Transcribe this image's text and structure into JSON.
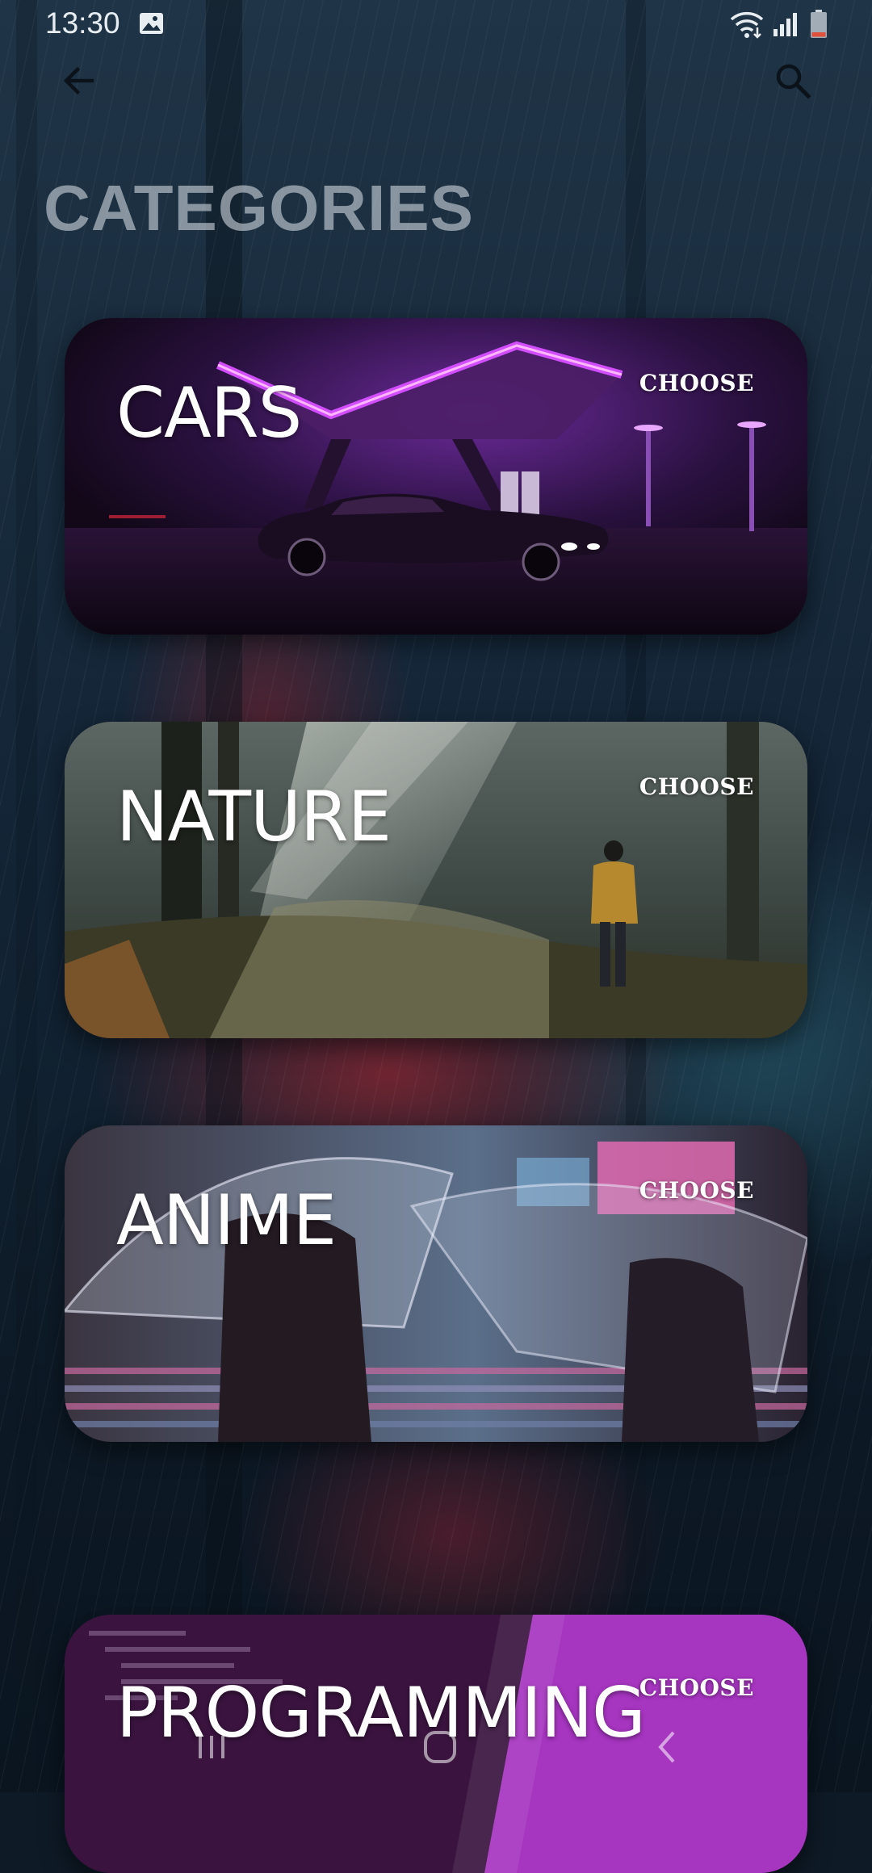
{
  "status_bar": {
    "time": "13:30",
    "icons": [
      "gallery-icon",
      "wifi-icon",
      "signal-icon",
      "battery-icon"
    ]
  },
  "app_bar": {
    "back_icon": "arrow-left-icon",
    "search_icon": "search-icon"
  },
  "page": {
    "title": "CATEGORIES"
  },
  "categories": [
    {
      "label": "CARS",
      "action": "CHOOSE"
    },
    {
      "label": "NATURE",
      "action": "CHOOSE"
    },
    {
      "label": "ANIME",
      "action": "CHOOSE"
    },
    {
      "label": "PROGRAMMING",
      "action": "CHOOSE"
    }
  ],
  "nav_bar": {
    "icons": [
      "recents-icon",
      "home-icon",
      "back-icon"
    ]
  },
  "colors": {
    "title": "#d7dee6",
    "card_text": "#ffffff",
    "battery_low": "#e0513b"
  }
}
